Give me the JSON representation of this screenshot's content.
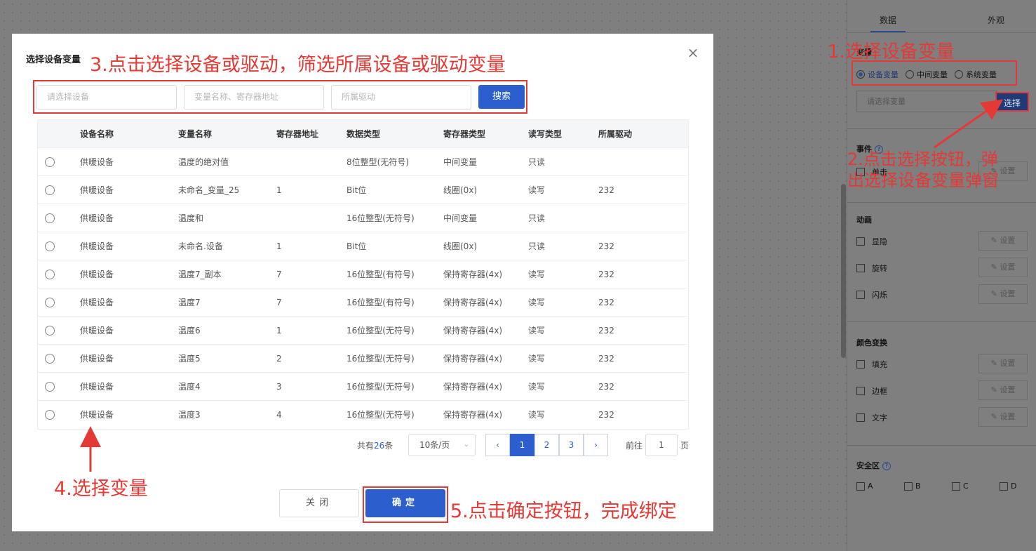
{
  "panel": {
    "tabs": [
      "数据",
      "外观"
    ],
    "variable_section": "变量",
    "radio_options": [
      "设备变量",
      "中间变量",
      "系统变量"
    ],
    "variable_placeholder": "请选择变量",
    "select_button": "选择",
    "event_section": "事件",
    "event_items": [
      "单击"
    ],
    "animation_section": "动画",
    "animation_items": [
      "显隐",
      "旋转",
      "闪烁"
    ],
    "color_section": "颜色变换",
    "color_items": [
      "填充",
      "边框",
      "文字"
    ],
    "setting_label": "设置",
    "safe_zone_section": "安全区",
    "safe_zone_items": [
      "A",
      "B",
      "C",
      "D"
    ]
  },
  "dialog": {
    "title": "选择设备变量",
    "filters": {
      "device_placeholder": "请选择设备",
      "variable_placeholder": "变量名称、寄存器地址",
      "driver_placeholder": "所属驱动",
      "search_button": "搜索"
    },
    "table": {
      "headers": [
        "设备名称",
        "变量名称",
        "寄存器地址",
        "数据类型",
        "寄存器类型",
        "读写类型",
        "所属驱动"
      ],
      "rows": [
        [
          "供暖设备",
          "温度的绝对值",
          "",
          "8位整型(无符号)",
          "中间变量",
          "只读",
          ""
        ],
        [
          "供暖设备",
          "未命名_变量_25",
          "1",
          "Bit位",
          "线圈(0x)",
          "读写",
          "232"
        ],
        [
          "供暖设备",
          "温度和",
          "",
          "16位整型(无符号)",
          "中间变量",
          "只读",
          ""
        ],
        [
          "供暖设备",
          "未命名.设备",
          "1",
          "Bit位",
          "线圈(0x)",
          "只读",
          "232"
        ],
        [
          "供暖设备",
          "温度7_副本",
          "7",
          "16位整型(有符号)",
          "保持寄存器(4x)",
          "读写",
          "232"
        ],
        [
          "供暖设备",
          "温度7",
          "7",
          "16位整型(有符号)",
          "保持寄存器(4x)",
          "读写",
          "232"
        ],
        [
          "供暖设备",
          "温度6",
          "1",
          "16位整型(无符号)",
          "保持寄存器(4x)",
          "读写",
          "232"
        ],
        [
          "供暖设备",
          "温度5",
          "2",
          "16位整型(无符号)",
          "保持寄存器(4x)",
          "读写",
          "232"
        ],
        [
          "供暖设备",
          "温度4",
          "3",
          "16位整型(无符号)",
          "保持寄存器(4x)",
          "读写",
          "232"
        ],
        [
          "供暖设备",
          "温度3",
          "4",
          "16位整型(无符号)",
          "保持寄存器(4x)",
          "读写",
          "232"
        ]
      ]
    },
    "pagination": {
      "total_prefix": "共有",
      "total": "26",
      "total_suffix": "条",
      "page_size": "10条/页",
      "pages": [
        "1",
        "2",
        "3"
      ],
      "current_page": "1",
      "goto_label": "前往",
      "goto_value": "1",
      "goto_suffix": "页"
    },
    "close_button": "关闭",
    "confirm_button": "确定"
  },
  "annotations": {
    "step1": "1.选择设备变量",
    "step2_line1": "2.点击选择按钮，弹",
    "step2_line2": "出选择设备变量弹窗",
    "step3": "3.点击选择设备或驱动，筛选所属设备或驱动变量",
    "step4": "4.选择变量",
    "step5": "5.点击确定按钮，完成绑定"
  },
  "colors": {
    "primary": "#2c5fcd",
    "annotation": "#e53935",
    "overlay": "#7f7f7f"
  }
}
